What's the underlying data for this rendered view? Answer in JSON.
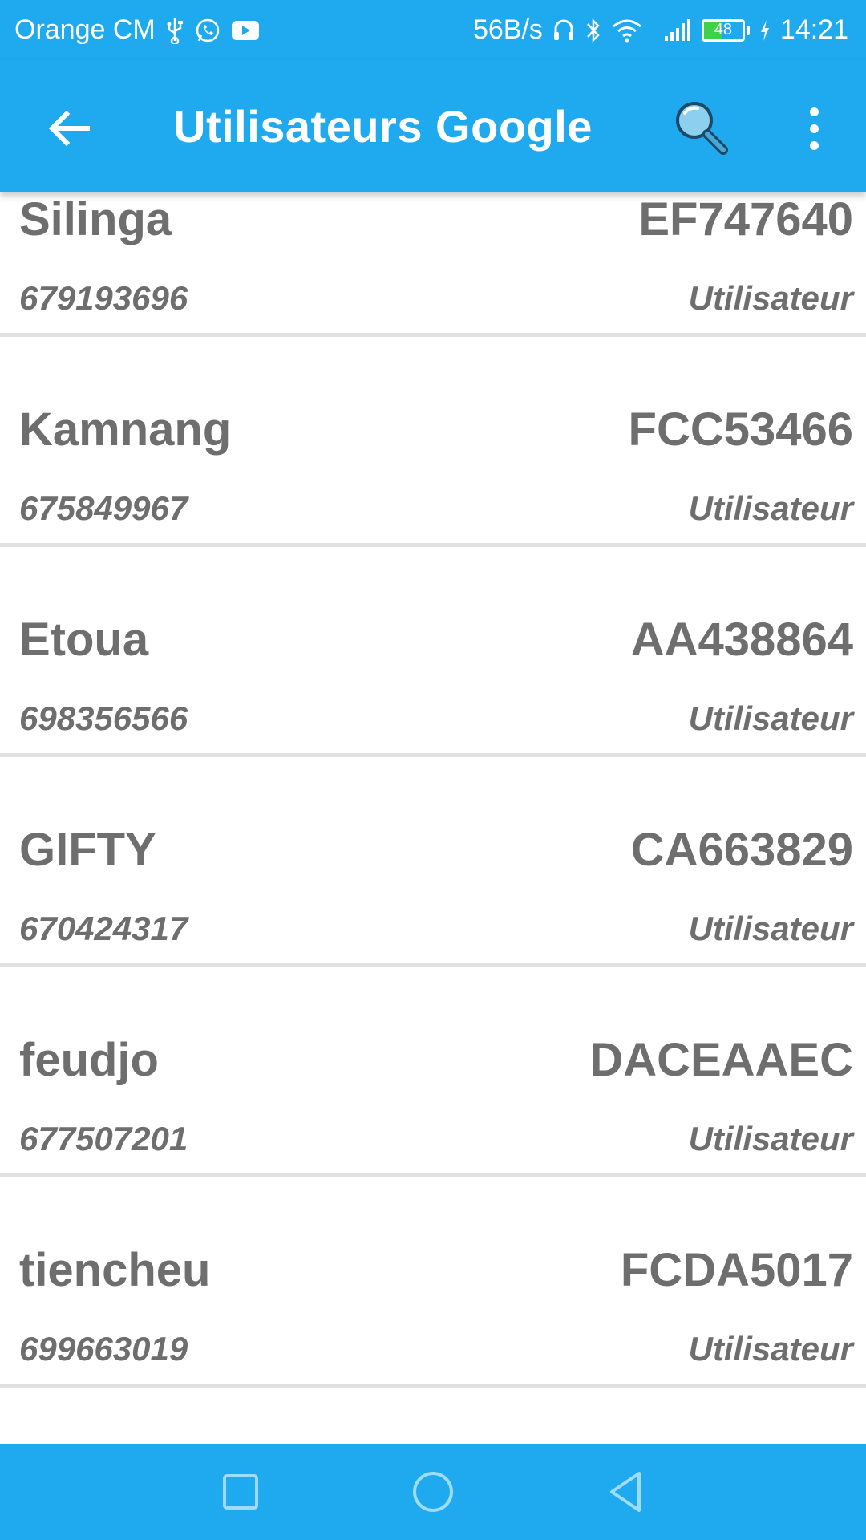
{
  "status_bar": {
    "carrier": "Orange CM",
    "net_speed": "56B/s",
    "battery_level": "48",
    "battery_fraction": 0.48,
    "time": "14:21",
    "icons": [
      "usb-icon",
      "whatsapp-icon",
      "youtube-icon",
      "headset-icon",
      "bluetooth-icon",
      "wifi-icon",
      "signal-icon",
      "battery-icon",
      "charging-icon"
    ]
  },
  "app_bar": {
    "title": "Utilisateurs Google",
    "icons": [
      "back-arrow-icon",
      "search-icon",
      "more-vert-icon"
    ]
  },
  "users": [
    {
      "name": "Silinga",
      "code": "EF747640",
      "phone": "679193696",
      "role": "Utilisateur"
    },
    {
      "name": "Kamnang",
      "code": "FCC53466",
      "phone": "675849967",
      "role": "Utilisateur"
    },
    {
      "name": "Etoua",
      "code": "AA438864",
      "phone": "698356566",
      "role": "Utilisateur"
    },
    {
      "name": "GIFTY",
      "code": "CA663829",
      "phone": "670424317",
      "role": "Utilisateur"
    },
    {
      "name": "feudjo",
      "code": "DACEAAEC",
      "phone": "677507201",
      "role": "Utilisateur"
    },
    {
      "name": "tiencheu",
      "code": "FCDA5017",
      "phone": "699663019",
      "role": "Utilisateur"
    }
  ],
  "nav_bar": {
    "icons": [
      "recent-apps-icon",
      "home-icon",
      "back-icon"
    ]
  },
  "colors": {
    "primary": "#1faaf0",
    "text_gray": "#6e6e6e",
    "divider": "#e0e0e0"
  }
}
